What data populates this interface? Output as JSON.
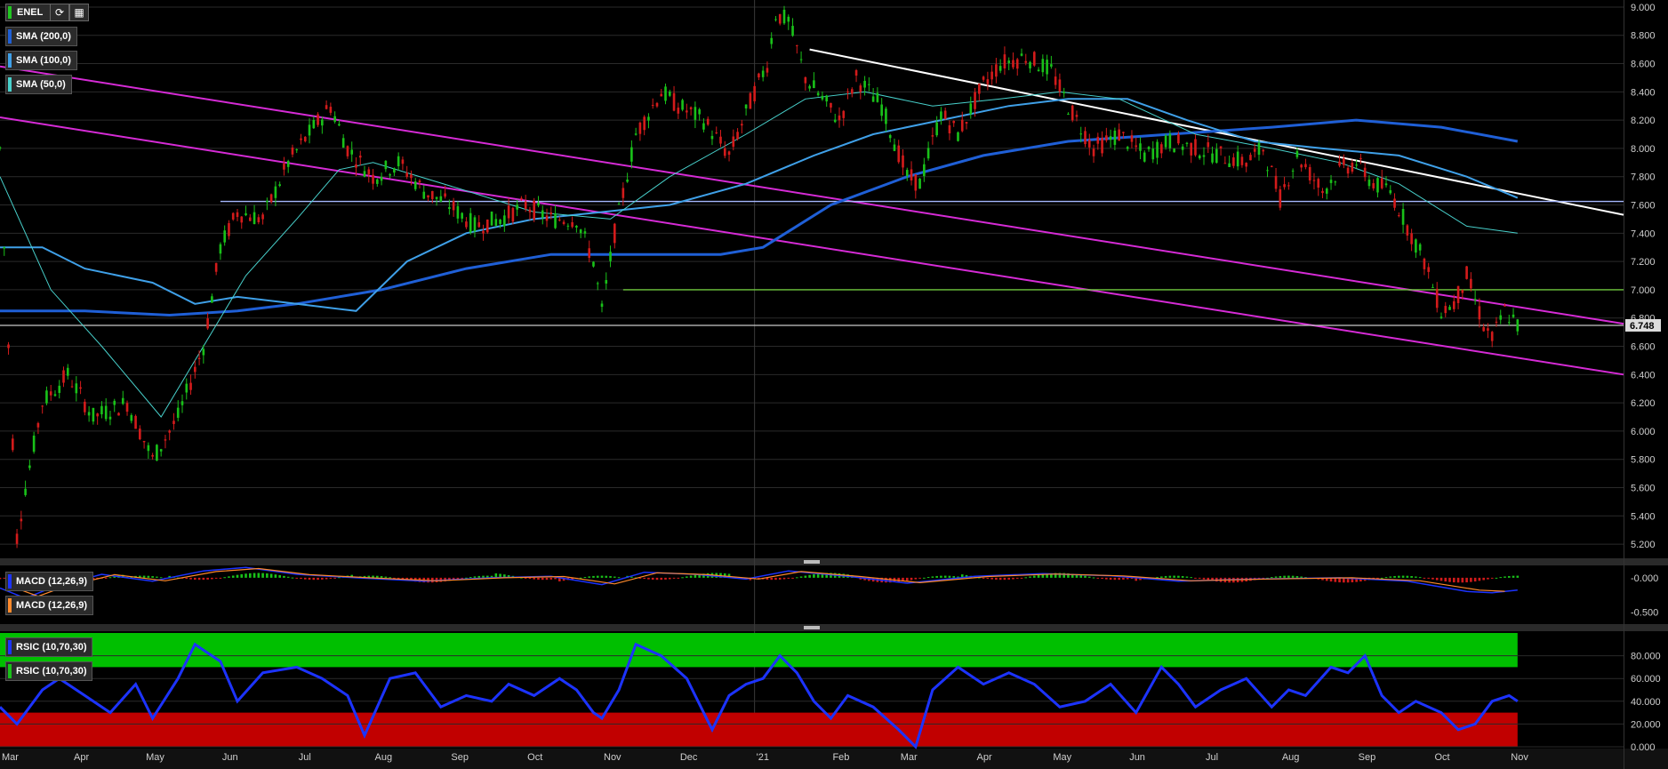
{
  "ticker": "ENEL",
  "toolbar": {
    "refresh_icon": "refresh-icon",
    "calendar_icon": "calendar-icon"
  },
  "indicators": {
    "sma200": "SMA (200,0)",
    "sma100": "SMA (100,0)",
    "sma50": "SMA (50,0)",
    "macd_a": "MACD (12,26,9)",
    "macd_b": "MACD (12,26,9)",
    "rsi_a": "RSIC (10,70,30)",
    "rsi_b": "RSIC (10,70,30)"
  },
  "colors": {
    "up": "#19c119",
    "down": "#d31b1b",
    "sma200": "#1f5fd6",
    "sma100": "#3fa0e8",
    "sma50": "#48d1cc",
    "channel": "#d62bd6",
    "trend": "#ffffff",
    "support": "#a6b8ff",
    "level7": "#6ec83c",
    "rsi_line": "#1c33ff",
    "rsi_over": "#00bf00",
    "rsi_under": "#c10000"
  },
  "chart_data": {
    "type": "candlestick",
    "current_price": "6.748",
    "x_tick_labels": [
      "Mar",
      "Apr",
      "May",
      "Jun",
      "Jul",
      "Aug",
      "Sep",
      "Oct",
      "Nov",
      "Dec",
      "'21",
      "Feb",
      "Mar",
      "Apr",
      "May",
      "Jun",
      "Jul",
      "Aug",
      "Sep",
      "Oct",
      "Nov"
    ],
    "price_axis": {
      "ylim": [
        5.1,
        9.05
      ],
      "ticks": [
        "9.000",
        "8.800",
        "8.600",
        "8.400",
        "8.200",
        "8.000",
        "7.800",
        "7.600",
        "7.400",
        "7.200",
        "7.000",
        "6.800",
        "6.600",
        "6.400",
        "6.200",
        "6.000",
        "5.800",
        "5.600",
        "5.400",
        "5.200"
      ]
    },
    "price_waypoints": [
      {
        "t": 0,
        "v": 8.0
      },
      {
        "t": 2,
        "v": 6.6
      },
      {
        "t": 4,
        "v": 5.25
      },
      {
        "t": 6,
        "v": 5.6
      },
      {
        "t": 10,
        "v": 6.2
      },
      {
        "t": 16,
        "v": 6.4
      },
      {
        "t": 22,
        "v": 6.1
      },
      {
        "t": 30,
        "v": 6.2
      },
      {
        "t": 36,
        "v": 5.8
      },
      {
        "t": 42,
        "v": 6.1
      },
      {
        "t": 48,
        "v": 6.6
      },
      {
        "t": 52,
        "v": 7.3
      },
      {
        "t": 56,
        "v": 7.55
      },
      {
        "t": 62,
        "v": 7.5
      },
      {
        "t": 68,
        "v": 7.9
      },
      {
        "t": 74,
        "v": 8.15
      },
      {
        "t": 78,
        "v": 8.3
      },
      {
        "t": 82,
        "v": 8.0
      },
      {
        "t": 88,
        "v": 7.8
      },
      {
        "t": 94,
        "v": 7.9
      },
      {
        "t": 100,
        "v": 7.7
      },
      {
        "t": 106,
        "v": 7.6
      },
      {
        "t": 112,
        "v": 7.45
      },
      {
        "t": 118,
        "v": 7.5
      },
      {
        "t": 124,
        "v": 7.6
      },
      {
        "t": 130,
        "v": 7.5
      },
      {
        "t": 136,
        "v": 7.5
      },
      {
        "t": 140,
        "v": 7.2
      },
      {
        "t": 142,
        "v": 6.85
      },
      {
        "t": 145,
        "v": 7.4
      },
      {
        "t": 150,
        "v": 8.1
      },
      {
        "t": 156,
        "v": 8.4
      },
      {
        "t": 160,
        "v": 8.3
      },
      {
        "t": 166,
        "v": 8.2
      },
      {
        "t": 172,
        "v": 7.95
      },
      {
        "t": 178,
        "v": 8.4
      },
      {
        "t": 181,
        "v": 8.6
      },
      {
        "t": 183,
        "v": 8.95
      },
      {
        "t": 186,
        "v": 8.9
      },
      {
        "t": 190,
        "v": 8.5
      },
      {
        "t": 194,
        "v": 8.35
      },
      {
        "t": 198,
        "v": 8.2
      },
      {
        "t": 202,
        "v": 8.5
      },
      {
        "t": 208,
        "v": 8.3
      },
      {
        "t": 214,
        "v": 7.8
      },
      {
        "t": 217,
        "v": 7.75
      },
      {
        "t": 222,
        "v": 8.25
      },
      {
        "t": 226,
        "v": 8.1
      },
      {
        "t": 232,
        "v": 8.45
      },
      {
        "t": 236,
        "v": 8.6
      },
      {
        "t": 242,
        "v": 8.65
      },
      {
        "t": 248,
        "v": 8.55
      },
      {
        "t": 252,
        "v": 8.3
      },
      {
        "t": 258,
        "v": 8.0
      },
      {
        "t": 264,
        "v": 8.1
      },
      {
        "t": 270,
        "v": 7.95
      },
      {
        "t": 276,
        "v": 8.05
      },
      {
        "t": 282,
        "v": 8.0
      },
      {
        "t": 288,
        "v": 7.95
      },
      {
        "t": 294,
        "v": 7.9
      },
      {
        "t": 298,
        "v": 8.0
      },
      {
        "t": 302,
        "v": 7.65
      },
      {
        "t": 306,
        "v": 7.95
      },
      {
        "t": 312,
        "v": 7.7
      },
      {
        "t": 316,
        "v": 7.85
      },
      {
        "t": 320,
        "v": 7.9
      },
      {
        "t": 324,
        "v": 7.75
      },
      {
        "t": 328,
        "v": 7.7
      },
      {
        "t": 332,
        "v": 7.45
      },
      {
        "t": 336,
        "v": 7.2
      },
      {
        "t": 340,
        "v": 6.85
      },
      {
        "t": 343,
        "v": 6.9
      },
      {
        "t": 346,
        "v": 7.1
      },
      {
        "t": 350,
        "v": 6.75
      },
      {
        "t": 352,
        "v": 6.65
      },
      {
        "t": 355,
        "v": 6.85
      },
      {
        "t": 358,
        "v": 6.75
      }
    ],
    "sma50_waypoints": [
      {
        "t": 0,
        "v": 7.8
      },
      {
        "t": 12,
        "v": 7.0
      },
      {
        "t": 24,
        "v": 6.6
      },
      {
        "t": 38,
        "v": 6.1
      },
      {
        "t": 46,
        "v": 6.5
      },
      {
        "t": 58,
        "v": 7.1
      },
      {
        "t": 70,
        "v": 7.5
      },
      {
        "t": 80,
        "v": 7.85
      },
      {
        "t": 88,
        "v": 7.9
      },
      {
        "t": 110,
        "v": 7.7
      },
      {
        "t": 126,
        "v": 7.55
      },
      {
        "t": 144,
        "v": 7.5
      },
      {
        "t": 158,
        "v": 7.8
      },
      {
        "t": 176,
        "v": 8.1
      },
      {
        "t": 190,
        "v": 8.35
      },
      {
        "t": 204,
        "v": 8.4
      },
      {
        "t": 220,
        "v": 8.3
      },
      {
        "t": 236,
        "v": 8.35
      },
      {
        "t": 250,
        "v": 8.4
      },
      {
        "t": 264,
        "v": 8.35
      },
      {
        "t": 282,
        "v": 8.1
      },
      {
        "t": 300,
        "v": 8.0
      },
      {
        "t": 316,
        "v": 7.9
      },
      {
        "t": 330,
        "v": 7.75
      },
      {
        "t": 346,
        "v": 7.45
      },
      {
        "t": 358,
        "v": 7.4
      }
    ],
    "sma100_waypoints": [
      {
        "t": 0,
        "v": 7.3
      },
      {
        "t": 10,
        "v": 7.3
      },
      {
        "t": 20,
        "v": 7.15
      },
      {
        "t": 36,
        "v": 7.05
      },
      {
        "t": 46,
        "v": 6.9
      },
      {
        "t": 56,
        "v": 6.95
      },
      {
        "t": 70,
        "v": 6.9
      },
      {
        "t": 84,
        "v": 6.85
      },
      {
        "t": 96,
        "v": 7.2
      },
      {
        "t": 110,
        "v": 7.4
      },
      {
        "t": 126,
        "v": 7.5
      },
      {
        "t": 142,
        "v": 7.55
      },
      {
        "t": 158,
        "v": 7.6
      },
      {
        "t": 176,
        "v": 7.75
      },
      {
        "t": 192,
        "v": 7.95
      },
      {
        "t": 206,
        "v": 8.1
      },
      {
        "t": 222,
        "v": 8.2
      },
      {
        "t": 238,
        "v": 8.3
      },
      {
        "t": 252,
        "v": 8.35
      },
      {
        "t": 266,
        "v": 8.35
      },
      {
        "t": 280,
        "v": 8.2
      },
      {
        "t": 296,
        "v": 8.05
      },
      {
        "t": 312,
        "v": 8.0
      },
      {
        "t": 330,
        "v": 7.95
      },
      {
        "t": 346,
        "v": 7.8
      },
      {
        "t": 358,
        "v": 7.65
      }
    ],
    "sma200_waypoints": [
      {
        "t": 0,
        "v": 6.85
      },
      {
        "t": 20,
        "v": 6.85
      },
      {
        "t": 40,
        "v": 6.82
      },
      {
        "t": 56,
        "v": 6.85
      },
      {
        "t": 70,
        "v": 6.9
      },
      {
        "t": 90,
        "v": 7.0
      },
      {
        "t": 110,
        "v": 7.15
      },
      {
        "t": 130,
        "v": 7.25
      },
      {
        "t": 150,
        "v": 7.25
      },
      {
        "t": 170,
        "v": 7.25
      },
      {
        "t": 180,
        "v": 7.3
      },
      {
        "t": 196,
        "v": 7.6
      },
      {
        "t": 214,
        "v": 7.8
      },
      {
        "t": 232,
        "v": 7.95
      },
      {
        "t": 252,
        "v": 8.05
      },
      {
        "t": 276,
        "v": 8.1
      },
      {
        "t": 300,
        "v": 8.15
      },
      {
        "t": 320,
        "v": 8.2
      },
      {
        "t": 340,
        "v": 8.15
      },
      {
        "t": 358,
        "v": 8.05
      }
    ],
    "trendlines": [
      {
        "name": "channel-upper",
        "color": "channel",
        "t1": 0,
        "v1": 8.58,
        "t2": 383,
        "v2": 6.76
      },
      {
        "name": "channel-lower",
        "color": "channel",
        "t1": 0,
        "v1": 8.22,
        "t2": 383,
        "v2": 6.4
      },
      {
        "name": "resistance",
        "color": "trend",
        "t1": 191,
        "v1": 8.7,
        "t2": 383,
        "v2": 7.53
      },
      {
        "name": "support-7.62",
        "color": "support",
        "t1": 52,
        "v1": 7.625,
        "t2": 383,
        "v2": 7.625
      },
      {
        "name": "level-7.0",
        "color": "level7",
        "t1": 147,
        "v1": 7.0,
        "t2": 383,
        "v2": 7.0
      },
      {
        "name": "price-line",
        "color": "price",
        "t1": 0,
        "v1": 6.748,
        "t2": 383,
        "v2": 6.748
      }
    ],
    "macd_axis": {
      "ylim": [
        -0.65,
        0.18
      ],
      "ticks": [
        "-0.000",
        "-0.500"
      ]
    },
    "macd_waypoints": [
      {
        "t": 0,
        "v": -0.15
      },
      {
        "t": 6,
        "v": -0.3
      },
      {
        "t": 12,
        "v": -0.15
      },
      {
        "t": 24,
        "v": 0.05
      },
      {
        "t": 36,
        "v": -0.05
      },
      {
        "t": 48,
        "v": 0.1
      },
      {
        "t": 58,
        "v": 0.15
      },
      {
        "t": 70,
        "v": 0.05
      },
      {
        "t": 84,
        "v": 0.0
      },
      {
        "t": 100,
        "v": -0.05
      },
      {
        "t": 116,
        "v": 0.0
      },
      {
        "t": 130,
        "v": 0.02
      },
      {
        "t": 142,
        "v": -0.1
      },
      {
        "t": 152,
        "v": 0.08
      },
      {
        "t": 164,
        "v": 0.05
      },
      {
        "t": 176,
        "v": -0.02
      },
      {
        "t": 186,
        "v": 0.1
      },
      {
        "t": 200,
        "v": 0.02
      },
      {
        "t": 214,
        "v": -0.08
      },
      {
        "t": 230,
        "v": 0.02
      },
      {
        "t": 246,
        "v": 0.06
      },
      {
        "t": 262,
        "v": 0.03
      },
      {
        "t": 278,
        "v": -0.05
      },
      {
        "t": 296,
        "v": -0.02
      },
      {
        "t": 316,
        "v": 0.0
      },
      {
        "t": 332,
        "v": -0.05
      },
      {
        "t": 346,
        "v": -0.2
      },
      {
        "t": 352,
        "v": -0.22
      },
      {
        "t": 358,
        "v": -0.18
      }
    ],
    "rsi_axis": {
      "ylim": [
        0,
        100
      ],
      "overbought": 70,
      "oversold": 30,
      "ticks": [
        "80.000",
        "60.000",
        "40.000",
        "20.000",
        "0.000"
      ]
    },
    "rsi_waypoints": [
      {
        "t": 0,
        "v": 35
      },
      {
        "t": 4,
        "v": 20
      },
      {
        "t": 10,
        "v": 50
      },
      {
        "t": 14,
        "v": 60
      },
      {
        "t": 20,
        "v": 45
      },
      {
        "t": 26,
        "v": 30
      },
      {
        "t": 32,
        "v": 55
      },
      {
        "t": 36,
        "v": 25
      },
      {
        "t": 42,
        "v": 60
      },
      {
        "t": 46,
        "v": 90
      },
      {
        "t": 52,
        "v": 75
      },
      {
        "t": 56,
        "v": 40
      },
      {
        "t": 62,
        "v": 65
      },
      {
        "t": 70,
        "v": 70
      },
      {
        "t": 76,
        "v": 60
      },
      {
        "t": 82,
        "v": 45
      },
      {
        "t": 86,
        "v": 10
      },
      {
        "t": 92,
        "v": 60
      },
      {
        "t": 98,
        "v": 65
      },
      {
        "t": 104,
        "v": 35
      },
      {
        "t": 110,
        "v": 45
      },
      {
        "t": 116,
        "v": 40
      },
      {
        "t": 120,
        "v": 55
      },
      {
        "t": 126,
        "v": 45
      },
      {
        "t": 132,
        "v": 60
      },
      {
        "t": 136,
        "v": 50
      },
      {
        "t": 140,
        "v": 30
      },
      {
        "t": 142,
        "v": 25
      },
      {
        "t": 146,
        "v": 50
      },
      {
        "t": 150,
        "v": 90
      },
      {
        "t": 156,
        "v": 80
      },
      {
        "t": 162,
        "v": 60
      },
      {
        "t": 166,
        "v": 30
      },
      {
        "t": 168,
        "v": 15
      },
      {
        "t": 172,
        "v": 45
      },
      {
        "t": 176,
        "v": 55
      },
      {
        "t": 180,
        "v": 60
      },
      {
        "t": 184,
        "v": 80
      },
      {
        "t": 188,
        "v": 65
      },
      {
        "t": 192,
        "v": 40
      },
      {
        "t": 196,
        "v": 25
      },
      {
        "t": 200,
        "v": 45
      },
      {
        "t": 206,
        "v": 35
      },
      {
        "t": 212,
        "v": 15
      },
      {
        "t": 216,
        "v": 0
      },
      {
        "t": 220,
        "v": 50
      },
      {
        "t": 226,
        "v": 70
      },
      {
        "t": 232,
        "v": 55
      },
      {
        "t": 238,
        "v": 65
      },
      {
        "t": 244,
        "v": 55
      },
      {
        "t": 250,
        "v": 35
      },
      {
        "t": 256,
        "v": 40
      },
      {
        "t": 262,
        "v": 55
      },
      {
        "t": 268,
        "v": 30
      },
      {
        "t": 274,
        "v": 70
      },
      {
        "t": 278,
        "v": 55
      },
      {
        "t": 282,
        "v": 35
      },
      {
        "t": 288,
        "v": 50
      },
      {
        "t": 294,
        "v": 60
      },
      {
        "t": 300,
        "v": 35
      },
      {
        "t": 304,
        "v": 50
      },
      {
        "t": 308,
        "v": 45
      },
      {
        "t": 314,
        "v": 70
      },
      {
        "t": 318,
        "v": 65
      },
      {
        "t": 322,
        "v": 80
      },
      {
        "t": 326,
        "v": 45
      },
      {
        "t": 330,
        "v": 30
      },
      {
        "t": 334,
        "v": 40
      },
      {
        "t": 340,
        "v": 30
      },
      {
        "t": 344,
        "v": 15
      },
      {
        "t": 348,
        "v": 20
      },
      {
        "t": 352,
        "v": 40
      },
      {
        "t": 356,
        "v": 45
      },
      {
        "t": 358,
        "v": 40
      }
    ]
  }
}
